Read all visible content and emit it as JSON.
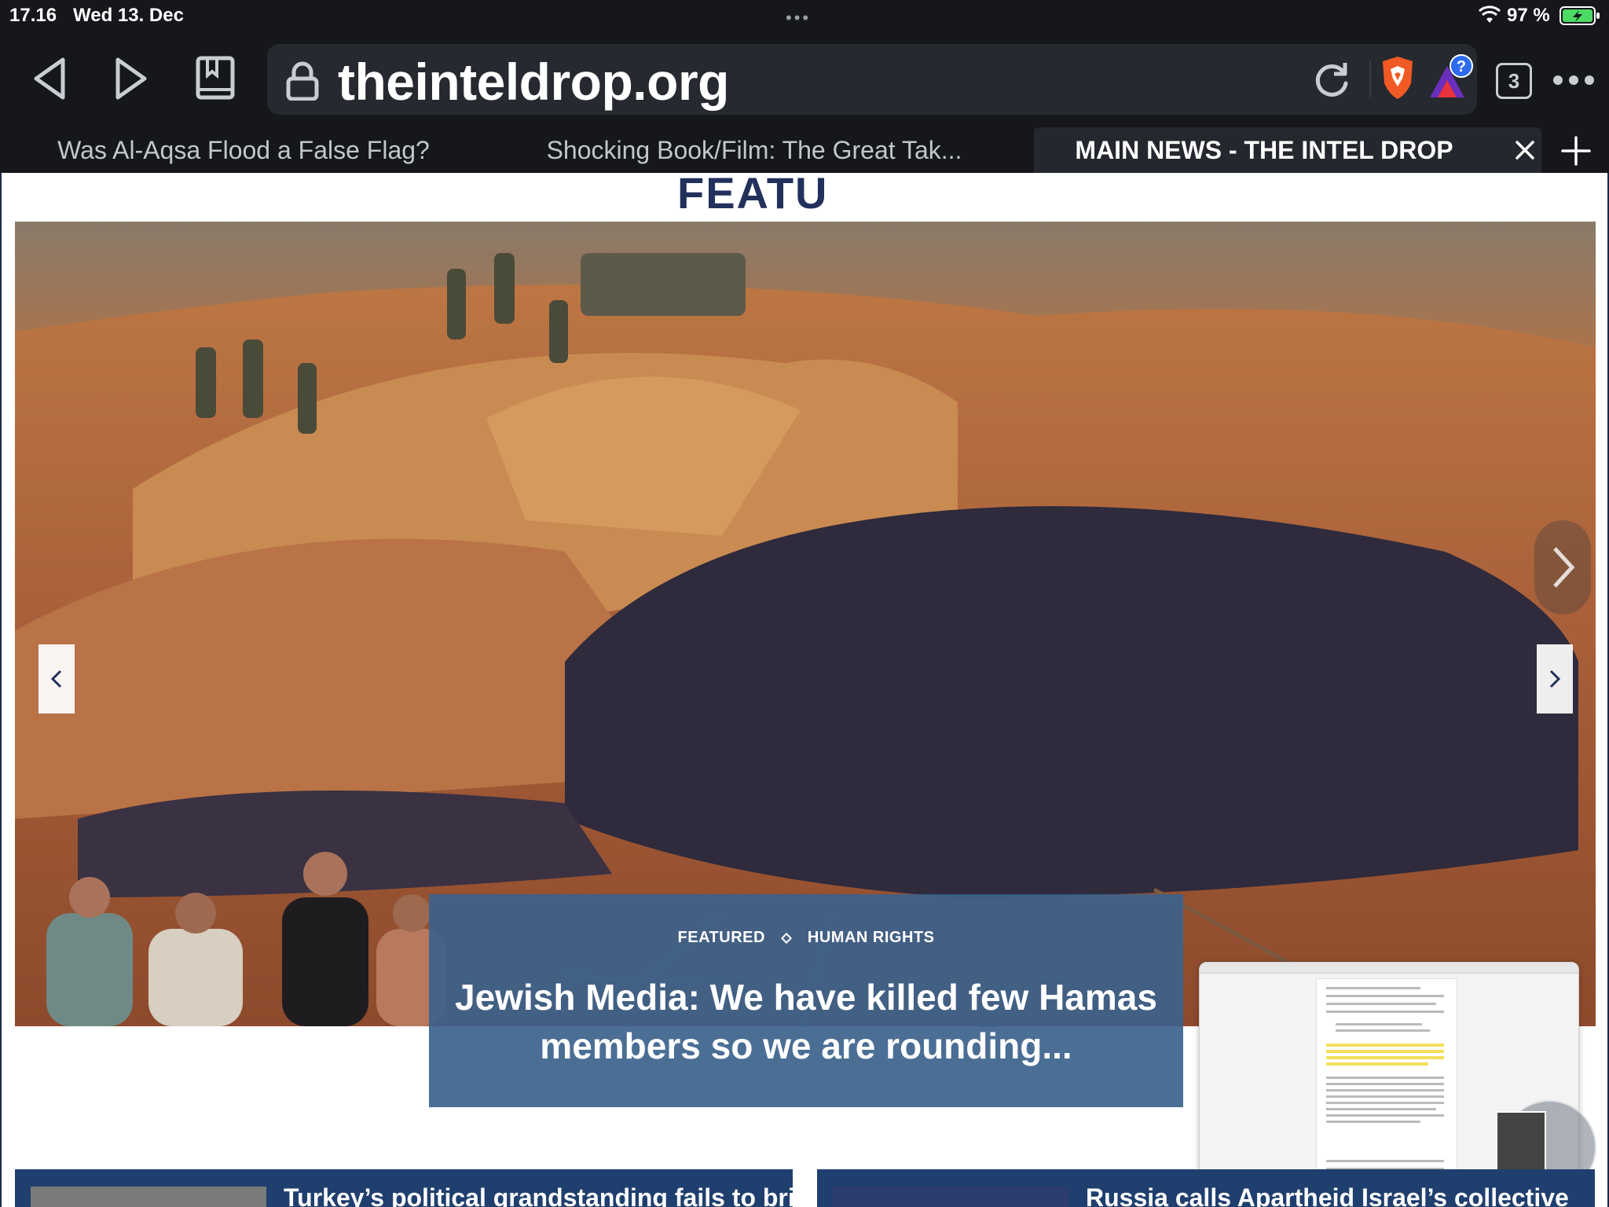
{
  "status_bar": {
    "time": "17.16",
    "date": "Wed 13. Dec",
    "battery": "97 %"
  },
  "browser": {
    "url": "theinteldrop.org",
    "tab_count": "3",
    "tabs": [
      {
        "label": "Was Al-Aqsa Flood a False Flag?",
        "active": false
      },
      {
        "label": "Shocking Book/Film: The Great Tak...",
        "active": false
      },
      {
        "label": "MAIN NEWS - THE INTEL DROP",
        "active": true
      }
    ]
  },
  "page": {
    "section_heading": "FEATU",
    "hero": {
      "categories": [
        "FEATURED",
        "HUMAN RIGHTS"
      ],
      "title": "Jewish Media: We have killed few Hamas members so we are rounding..."
    },
    "news_items": [
      {
        "headline": "Turkey’s political grandstanding fails to bring"
      },
      {
        "headline": "Russia calls Apartheid Israel’s collective"
      }
    ]
  },
  "colors": {
    "browser_chrome": "#15171b",
    "url_field": "#26292f",
    "heading_navy": "#22305c",
    "caption_overlay": "#3c628c",
    "news_bar": "#1f3f6e"
  }
}
